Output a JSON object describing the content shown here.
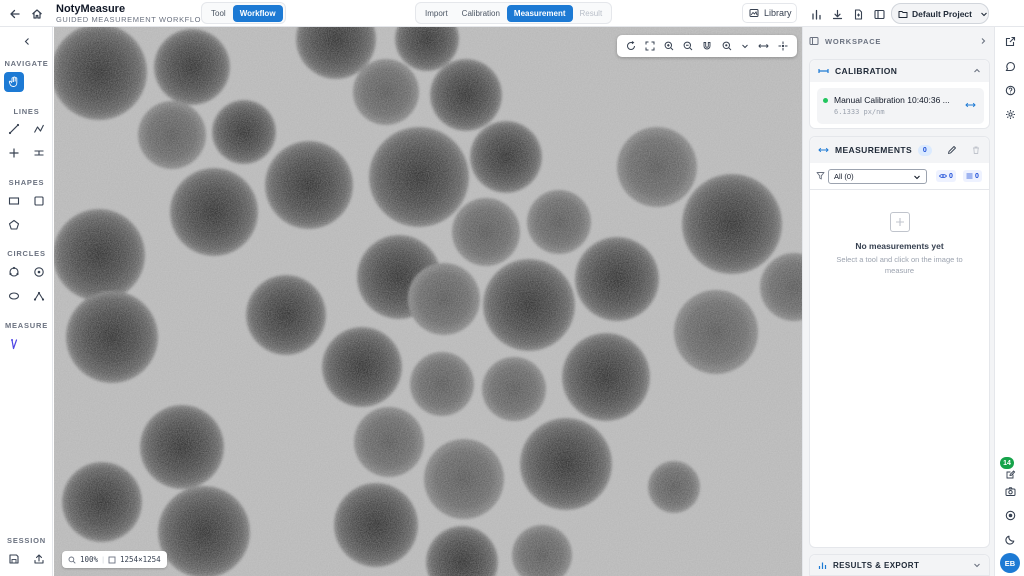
{
  "app": {
    "title": "NotyMeasure",
    "subtitle": "GUIDED MEASUREMENT WORKFLOW"
  },
  "mode_toggle": {
    "tool_label": "Tool",
    "workflow_label": "Workflow",
    "active": "Workflow"
  },
  "workflow_steps": [
    {
      "label": "Import",
      "state": "normal"
    },
    {
      "label": "Calibration",
      "state": "normal"
    },
    {
      "label": "Measurement",
      "state": "active"
    },
    {
      "label": "Result",
      "state": "disabled"
    }
  ],
  "header_actions": {
    "library_label": "Library",
    "project_label": "Default Project"
  },
  "left_tools": {
    "navigate": "NAVIGATE",
    "lines": "LINES",
    "shapes": "SHAPES",
    "circles": "CIRCLES",
    "measure": "MEASURE",
    "session": "SESSION"
  },
  "canvas": {
    "zoom_level": "100%",
    "image_size": "1254×1254"
  },
  "workspace": {
    "title": "WORKSPACE",
    "calibration": {
      "title": "CALIBRATION",
      "item_name": "Manual Calibration 10:40:36 ...",
      "item_scale": "6.1333 px/nm",
      "status_color": "#22c55e"
    },
    "measurements": {
      "title": "MEASUREMENTS",
      "count": "0",
      "filter_value": "All (0)",
      "visible_count": "0",
      "list_count": "0",
      "empty_title": "No measurements yet",
      "empty_hint": "Select a tool and click on the image to measure"
    },
    "results_title": "RESULTS & EXPORT"
  },
  "side_strip": {
    "notification_count": "14",
    "avatar_initials": "EB"
  },
  "colors": {
    "accent": "#1d7ad4",
    "badge_green": "#16a34a"
  }
}
